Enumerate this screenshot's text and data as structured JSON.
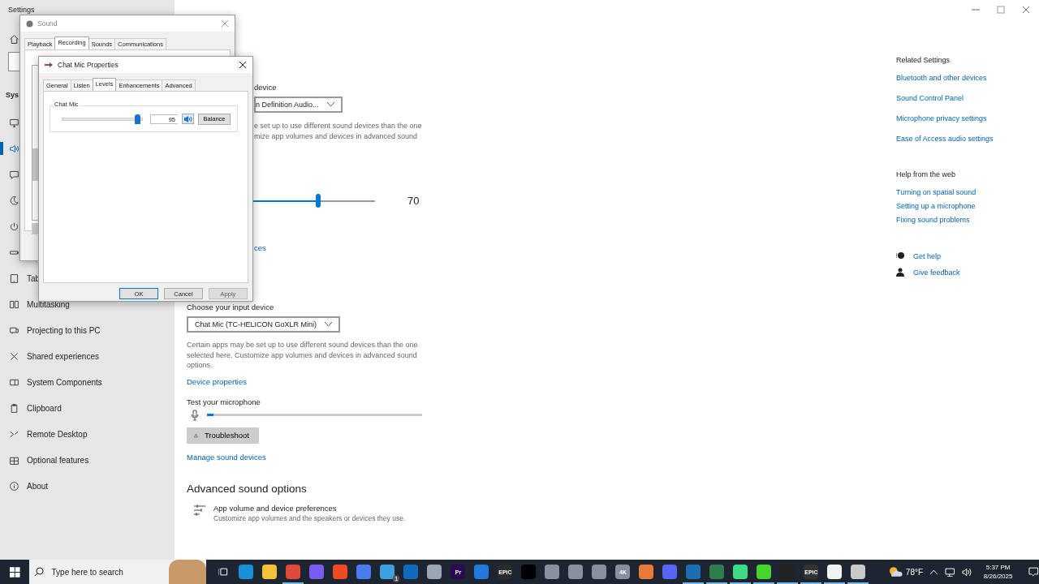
{
  "settings_window": {
    "title": "Settings"
  },
  "sidebar": {
    "heading": "Sys",
    "items": [
      {
        "selected": false
      },
      {
        "selected": true
      },
      {
        "selected": false
      },
      {
        "selected": false
      },
      {
        "selected": false
      },
      {
        "selected": false
      },
      {
        "label": "Tab",
        "selected": false
      },
      {
        "label": "Multitasking",
        "selected": false
      },
      {
        "label": "Projecting to this PC",
        "selected": false
      },
      {
        "label": "Shared experiences",
        "selected": false
      },
      {
        "label": "System Components",
        "selected": false
      },
      {
        "label": "Clipboard",
        "selected": false
      },
      {
        "label": "Remote Desktop",
        "selected": false
      },
      {
        "label": "Optional features",
        "selected": false
      },
      {
        "label": "About",
        "selected": false
      }
    ]
  },
  "output": {
    "label": "device",
    "dropdown": "n Definition Audio...",
    "description_lines": [
      "e set up to use different sound devices than the one",
      "mize app volumes and devices in advanced sound"
    ],
    "volume": {
      "level": 0.7,
      "reading": "70"
    },
    "link": "ces"
  },
  "input": {
    "label": "Choose your input device",
    "dropdown": "Chat Mic (TC-HELICON GoXLR Mini)",
    "description": "Certain apps may be set up to use different sound devices than the one selected here. Customize app volumes and devices in advanced sound options.",
    "properties_link": "Device properties",
    "test_label": "Test your microphone",
    "meter": {
      "level": 0.03
    },
    "troubleshoot": "Troubleshoot",
    "manage_link": "Manage sound devices"
  },
  "advanced": {
    "heading": "Advanced sound options",
    "item": {
      "title": "App volume and device preferences",
      "subtitle": "Customize app volumes and the speakers or devices they use."
    }
  },
  "related": {
    "heading": "Related Settings",
    "links": [
      "Bluetooth and other devices",
      "Sound Control Panel",
      "Microphone privacy settings",
      "Ease of Access audio settings"
    ]
  },
  "help": {
    "heading": "Help from the web",
    "links": [
      "Turning on spatial sound",
      "Setting up a microphone",
      "Fixing sound problems"
    ]
  },
  "support": [
    "Get help",
    "Give feedback"
  ],
  "sound_dialog": {
    "title": "Sound",
    "tabs": [
      {
        "label": "Playback",
        "selected": false
      },
      {
        "label": "Recording",
        "selected": true
      },
      {
        "label": "Sounds",
        "selected": false
      },
      {
        "label": "Communications",
        "selected": false
      }
    ]
  },
  "properties_dialog": {
    "title": "Chat Mic Properties",
    "tabs": [
      {
        "label": "General",
        "selected": false
      },
      {
        "label": "Listen",
        "selected": false
      },
      {
        "label": "Levels",
        "selected": true
      },
      {
        "label": "Enhancements",
        "selected": false
      },
      {
        "label": "Advanced",
        "selected": false
      }
    ],
    "group_label": "Chat Mic",
    "level": 0.95,
    "value": "95",
    "balance": "Balance",
    "buttons": [
      {
        "label": "OK",
        "default": true,
        "disabled": false
      },
      {
        "label": "Cancel",
        "default": false,
        "disabled": false
      },
      {
        "label": "Apply",
        "default": false,
        "disabled": true
      }
    ]
  },
  "taskbar": {
    "search_placeholder": "Type here to search",
    "apps": [
      {
        "color": "#1a8fd6",
        "running": false
      },
      {
        "color": "#f3c13a",
        "running": false
      },
      {
        "color": "#e04a3a",
        "running": true
      },
      {
        "color": "#7b5cf0",
        "running": false
      },
      {
        "color": "#f04a23",
        "running": false
      },
      {
        "color": "#4a7cf0",
        "running": false
      },
      {
        "color": "#3fa0e0",
        "running": false,
        "badge": "1"
      },
      {
        "color": "#0f6cbd",
        "running": false
      },
      {
        "color": "#9aa7b0",
        "running": false
      },
      {
        "color": "#2a0a52",
        "running": false,
        "glyph": "Pr"
      },
      {
        "color": "#1f7ad9",
        "running": false
      },
      {
        "color": "#2b2b2b",
        "running": false,
        "glyph": "EPIC"
      },
      {
        "color": "#000000",
        "running": false
      },
      {
        "color": "#8a8f9c",
        "running": false
      },
      {
        "color": "#8a8f9c",
        "running": false
      },
      {
        "color": "#8a8f9c",
        "running": false
      },
      {
        "color": "#8a8f9c",
        "running": false,
        "glyph": "4K"
      },
      {
        "color": "#e8793a",
        "running": false
      },
      {
        "color": "#5865f2",
        "running": false
      },
      {
        "color": "#1b6fb0",
        "running": true
      },
      {
        "color": "#2f7d4f",
        "running": true
      },
      {
        "color": "#3ddc84",
        "running": true
      },
      {
        "color": "#44d62c",
        "running": true
      },
      {
        "color": "#222222",
        "running": true
      },
      {
        "color": "#333333",
        "running": true,
        "glyph": "EPIC"
      },
      {
        "color": "#f2f2f2",
        "running": true
      },
      {
        "color": "#c8c8c8",
        "running": true
      }
    ],
    "temperature": "78°F",
    "time": "5:37 PM",
    "date": "8/26/2025"
  }
}
